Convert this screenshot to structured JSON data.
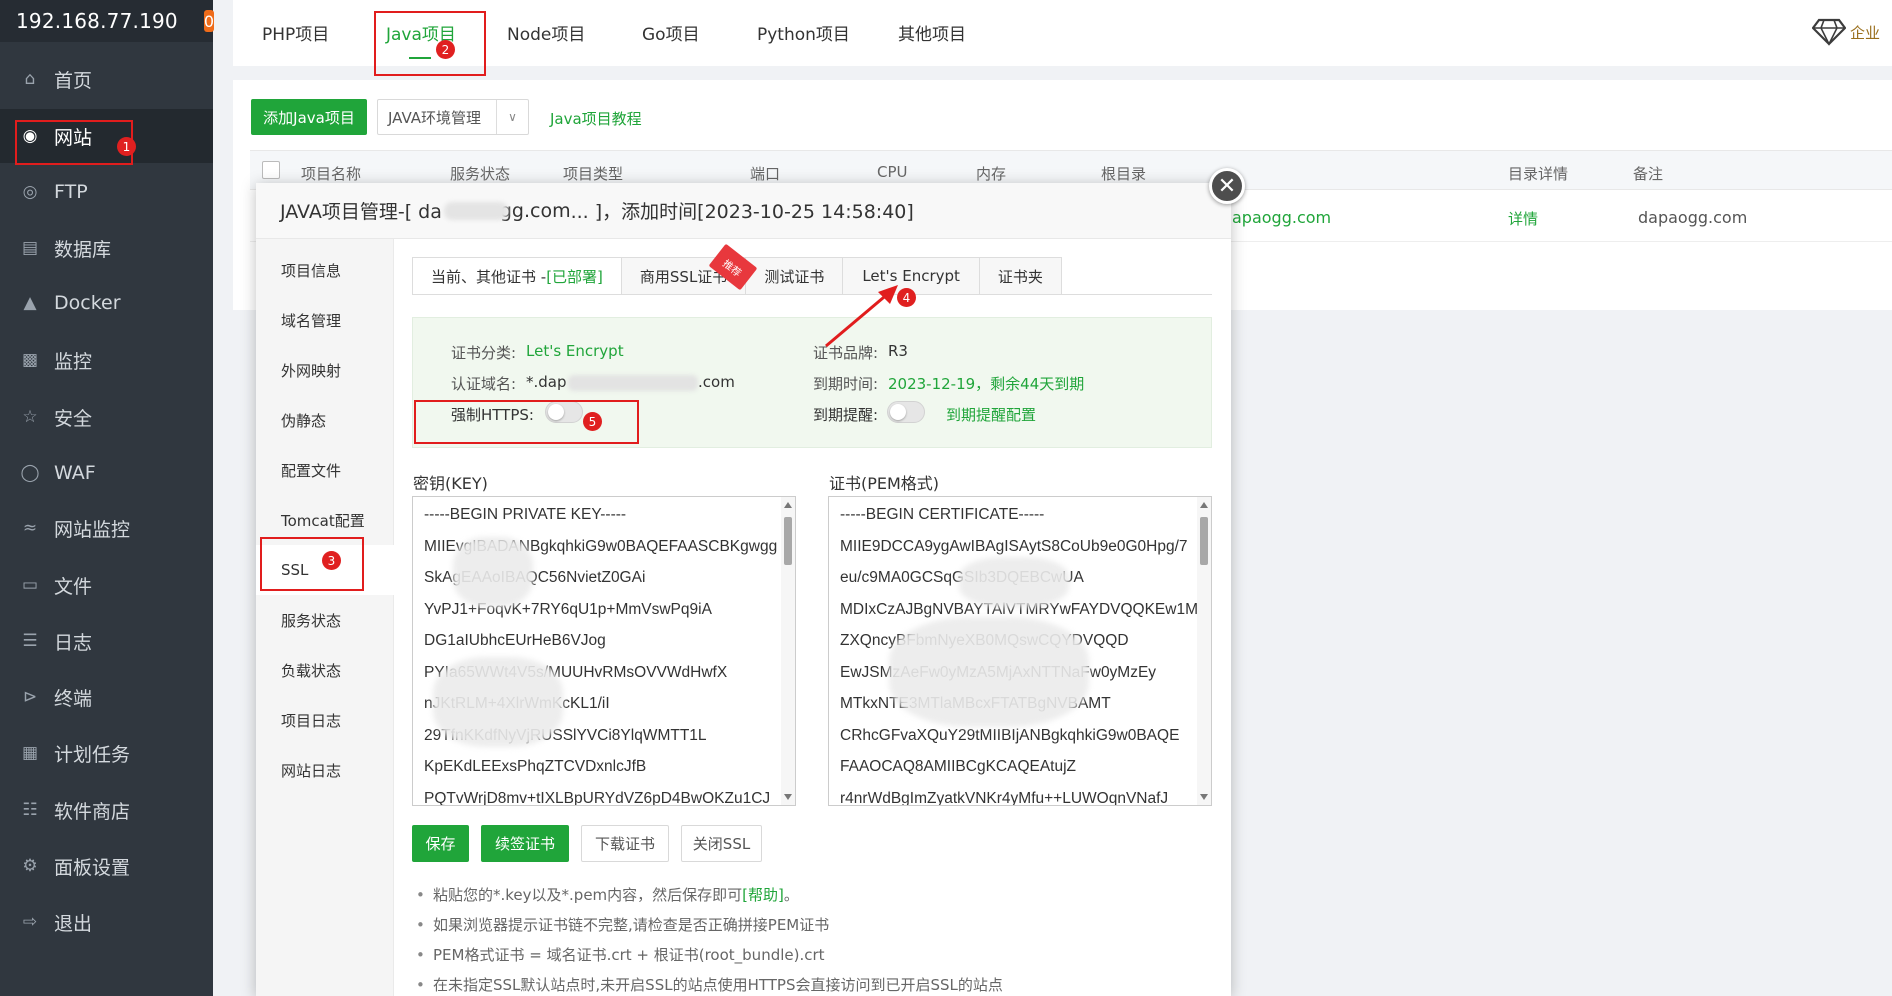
{
  "sidebar": {
    "ip": "192.168.77.190",
    "badge": "0",
    "items": [
      {
        "label": "首页",
        "icon": "home-icon"
      },
      {
        "label": "网站",
        "icon": "globe-icon"
      },
      {
        "label": "FTP",
        "icon": "ftp-icon"
      },
      {
        "label": "数据库",
        "icon": "database-icon"
      },
      {
        "label": "Docker",
        "icon": "docker-icon"
      },
      {
        "label": "监控",
        "icon": "monitor-icon"
      },
      {
        "label": "安全",
        "icon": "shield-icon"
      },
      {
        "label": "WAF",
        "icon": "waf-icon"
      },
      {
        "label": "网站监控",
        "icon": "chart-icon"
      },
      {
        "label": "文件",
        "icon": "folder-icon"
      },
      {
        "label": "日志",
        "icon": "log-icon"
      },
      {
        "label": "终端",
        "icon": "terminal-icon"
      },
      {
        "label": "计划任务",
        "icon": "calendar-icon"
      },
      {
        "label": "软件商店",
        "icon": "apps-icon"
      },
      {
        "label": "面板设置",
        "icon": "gear-icon"
      },
      {
        "label": "退出",
        "icon": "logout-icon"
      }
    ]
  },
  "topbar": {
    "tabs": [
      "PHP项目",
      "Java项目",
      "Node项目",
      "Go项目",
      "Python项目",
      "其他项目"
    ],
    "vip": "企业"
  },
  "content": {
    "add_button": "添加Java项目",
    "env_button": "JAVA环境管理",
    "tutorial_link": "Java项目教程",
    "columns": [
      "项目名称",
      "服务状态",
      "项目类型",
      "端口",
      "CPU",
      "内存",
      "根目录",
      "目录详情",
      "备注"
    ],
    "row": {
      "domain_fragment": "apaogg.com",
      "detail": "详情",
      "remark": "dapaogg.com"
    }
  },
  "modal": {
    "title_prefix": "JAVA项目管理-[ da",
    "title_mid": "gg.com",
    "title_suffix": "... ]，添加时间[2023-10-25 14:58:40]",
    "side_items": [
      "项目信息",
      "域名管理",
      "外网映射",
      "伪静态",
      "配置文件",
      "Tomcat配置",
      "SSL",
      "服务状态",
      "负载状态",
      "项目日志",
      "网站日志"
    ],
    "cert_tabs": {
      "current_label": "当前、其他证书 - ",
      "current_status": "[已部署]",
      "commercial": "商用SSL证书",
      "recommend_badge": "推荐",
      "test": "测试证书",
      "letsencrypt": "Let's Encrypt",
      "folder": "证书夹"
    },
    "cert_info": {
      "category_label": "证书分类:",
      "category_value": "Let's Encrypt",
      "brand_label": "证书品牌:",
      "brand_value": "R3",
      "domain_label": "认证域名:",
      "domain_value_prefix": "*.dap",
      "domain_value_suffix": ".com",
      "expire_label": "到期时间:",
      "expire_value": "2023-12-19，剩余44天到期",
      "https_label": "强制HTTPS:",
      "reminder_label": "到期提醒:",
      "reminder_link": "到期提醒配置"
    },
    "key_label": "密钥(KEY)",
    "cert_label": "证书(PEM格式)",
    "key_lines": [
      "-----BEGIN PRIVATE KEY-----",
      "MIIEvgIBADANBgkqhkiG9w0BAQEFAASCBKgwgg",
      "SkAgEAAoIBAQC56NvietZ0GAi",
      "YvPJ1+FoqvK+7RY6qU1p+MmVswPq9iA",
      "DG1aIUbhcEUrHeB6VJog",
      "PYIa65WWt4V5s/MUUHvRMsOVVWdHwfX",
      "nJKtRLM+4XlrWmKcKL1/iI",
      "29TfnKKdfNyVjRUSSlYVCi8YlqWMTT1L",
      "KpEKdLEExsPhqZTCVDxnlcJfB",
      "PQTvWrjD8mv+tIXLBpURYdVZ6pD4BwOKZu1CJ"
    ],
    "cert_lines": [
      "-----BEGIN CERTIFICATE-----",
      "MIIE9DCCA9ygAwIBAgISAytS8CoUb9e0G0Hpg/7",
      "eu/c9MA0GCSqGSIb3DQEBCwUA",
      "MDIxCzAJBgNVBAYTAlVTMRYwFAYDVQQKEw1M",
      "ZXQncyBFbmNyeXB0MQswCQYDVQQD",
      "EwJSMzAeFw0yMzA5MjAxNTTNaFw0yMzEy",
      "MTkxNTE3MTlaMBcxFTATBgNVBAMT",
      "CRhcGFvaXQuY29tMIIBIjANBgkqhkiG9w0BAQE",
      "FAAOCAQ8AMIIBCgKCAQEAtujZ",
      "r4nrWdBgImZyatkVNKr4yMfu++LUWOqnVNafJ"
    ],
    "buttons": {
      "save": "保存",
      "renew": "续签证书",
      "download": "下载证书",
      "close_ssl": "关闭SSL"
    },
    "tips": {
      "tip1_prefix": "粘贴您的*.key以及*.pem内容，然后保存即可",
      "tip1_link": "[帮助]",
      "tip1_suffix": "。",
      "tip2": "如果浏览器提示证书链不完整,请检查是否正确拼接PEM证书",
      "tip3": "PEM格式证书 = 域名证书.crt + 根证书(root_bundle).crt",
      "tip4": "在未指定SSL默认站点时,未开启SSL的站点使用HTTPS会直接访问到已开启SSL的站点"
    }
  },
  "markers": [
    "1",
    "2",
    "3",
    "4",
    "5"
  ],
  "colors": {
    "accent": "#20a53a",
    "sidebar_bg": "#30373f",
    "annotation": "#e11d1d"
  }
}
